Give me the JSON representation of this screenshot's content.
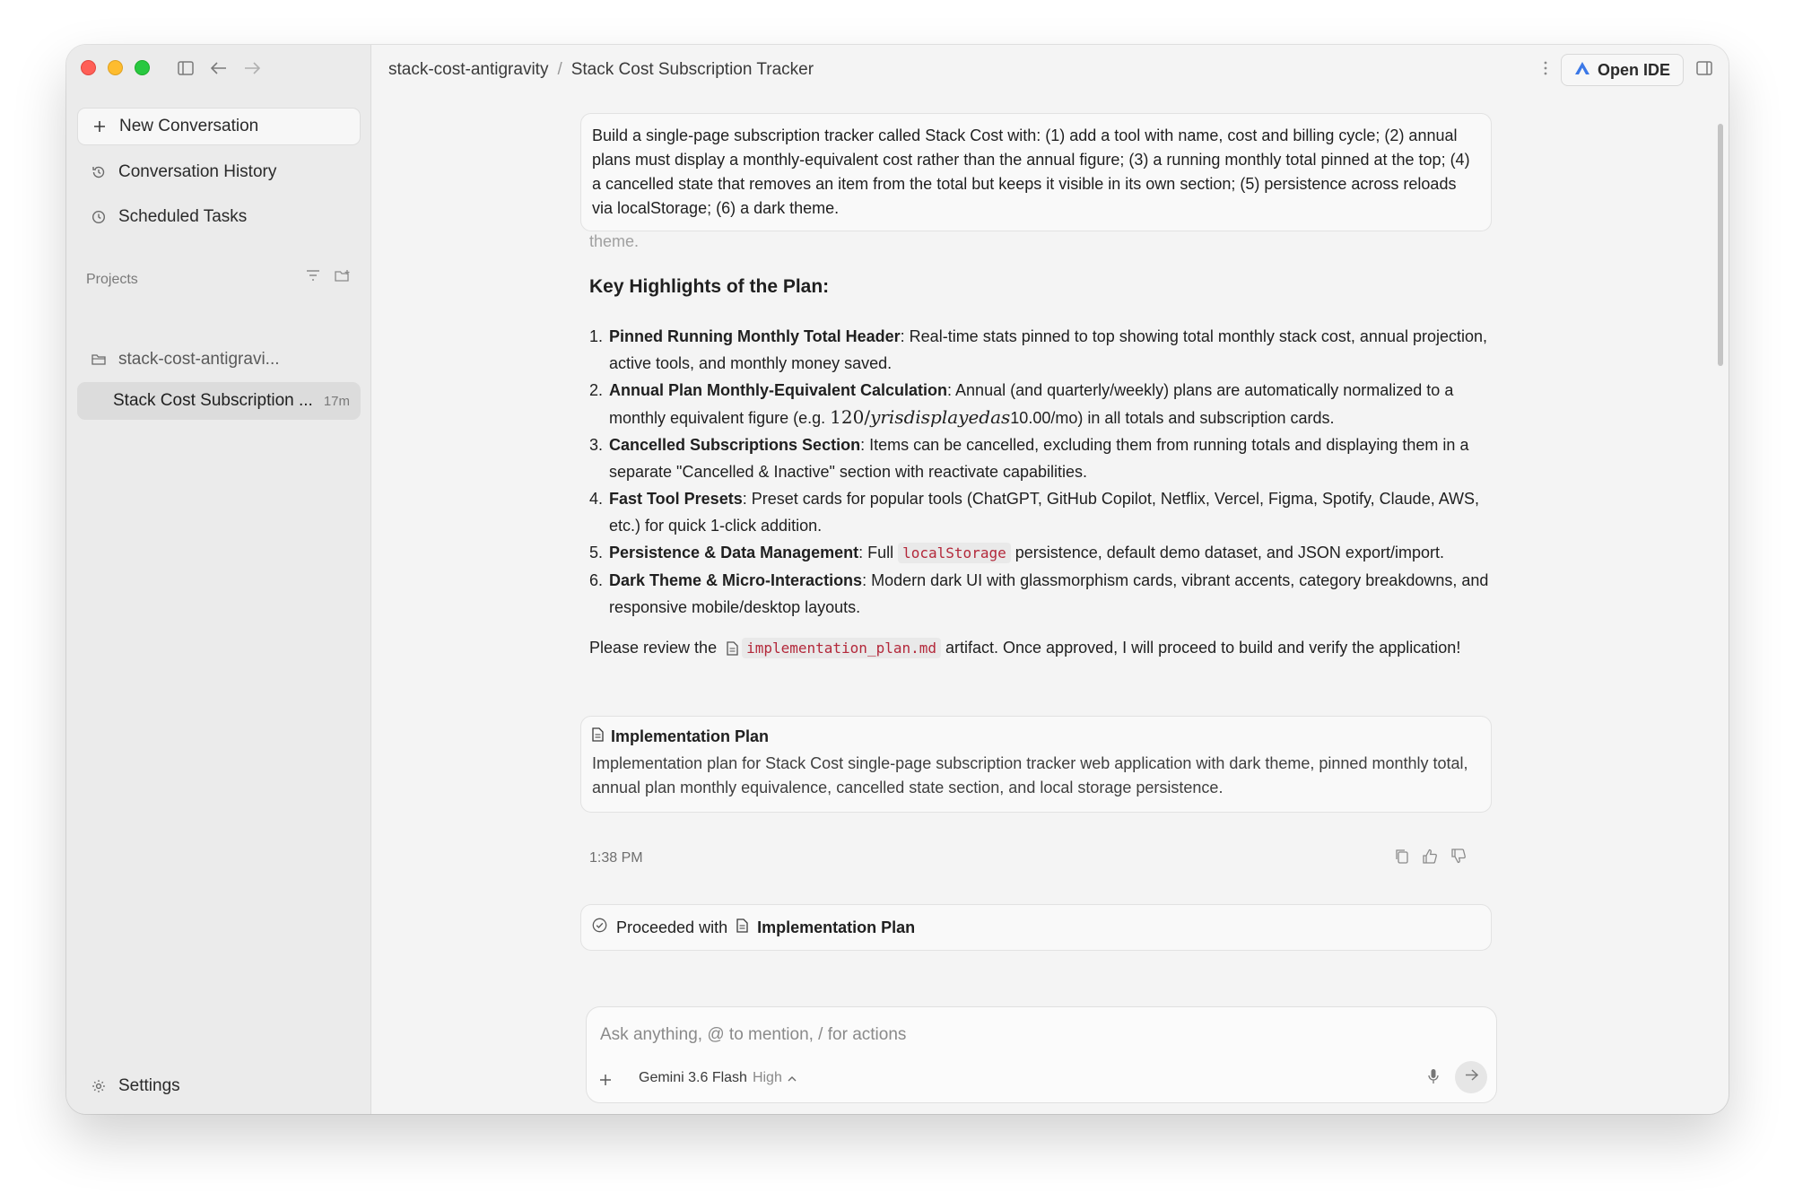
{
  "sidebar": {
    "new_conversation": "New Conversation",
    "conversation_history": "Conversation History",
    "scheduled_tasks": "Scheduled Tasks",
    "projects_label": "Projects",
    "project_folder": "stack-cost-antigravi...",
    "conversation_title": "Stack Cost Subscription ...",
    "conversation_age": "17m",
    "settings": "Settings"
  },
  "header": {
    "breadcrumb_project": "stack-cost-antigravity",
    "breadcrumb_sep": "/",
    "breadcrumb_title": "Stack Cost Subscription Tracker",
    "open_ide": "Open IDE"
  },
  "chat": {
    "user_message": "Build a single-page subscription tracker called Stack Cost with: (1) add a tool with name, cost and billing cycle; (2) annual plans must display a monthly-equivalent cost rather than the annual figure; (3) a running monthly total pinned at the top; (4) a cancelled state that removes an item from the total but keeps it visible in its own section; (5) persistence across reloads via localStorage; (6) a dark theme.",
    "cut_text": "theme.",
    "heading": "Key Highlights of the Plan:",
    "items": [
      {
        "num": "1.",
        "bold": "Pinned Running Monthly Total Header",
        "text": ": Real-time stats pinned to top showing total monthly stack cost, annual projection, active tools, and monthly money saved."
      },
      {
        "num": "2.",
        "bold": "Annual Plan Monthly-Equivalent Calculation",
        "text_a": ": Annual (and quarterly/weekly) plans are automatically normalized to a monthly equivalent figure (e.g. ",
        "math": "120/yrisdisplayedas",
        "text_b": "10.00/mo) in all totals and subscription cards."
      },
      {
        "num": "3.",
        "bold": "Cancelled Subscriptions Section",
        "text": ": Items can be cancelled, excluding them from running totals and displaying them in a separate \"Cancelled & Inactive\" section with reactivate capabilities."
      },
      {
        "num": "4.",
        "bold": "Fast Tool Presets",
        "text": ": Preset cards for popular tools (ChatGPT, GitHub Copilot, Netflix, Vercel, Figma, Spotify, Claude, AWS, etc.) for quick 1-click addition."
      },
      {
        "num": "5.",
        "bold": "Persistence & Data Management",
        "text_a": ": Full ",
        "code": "localStorage",
        "text_b": " persistence, default demo dataset, and JSON export/import."
      },
      {
        "num": "6.",
        "bold": "Dark Theme & Micro-Interactions",
        "text": ": Modern dark UI with glassmorphism cards, vibrant accents, category breakdowns, and responsive mobile/desktop layouts."
      }
    ],
    "review_a": "Please review the ",
    "review_file": "implementation_plan.md",
    "review_b": " artifact. Once approved, I will proceed to build and verify the application!",
    "artifact_title": "Implementation Plan",
    "artifact_desc": "Implementation plan for Stack Cost single-page subscription tracker web application with dark theme, pinned monthly total, annual plan monthly equivalence, cancelled state section, and local storage persistence.",
    "timestamp": "1:38 PM",
    "proceeded_label": "Proceeded with",
    "proceeded_target": "Implementation Plan"
  },
  "composer": {
    "placeholder": "Ask anything, @ to mention, / for actions",
    "model": "Gemini 3.6 Flash",
    "level": "High"
  },
  "colors": {
    "close": "#ff5f57",
    "minimize": "#febc2e",
    "zoom": "#28c840",
    "code_text": "#b3283a"
  }
}
